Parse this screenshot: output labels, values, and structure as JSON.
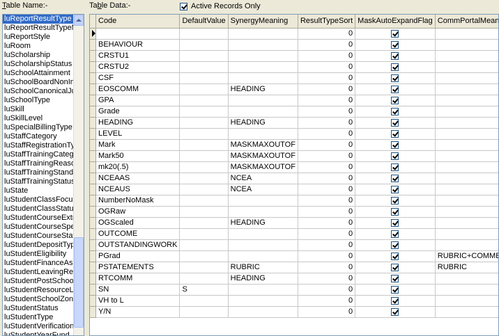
{
  "labels": {
    "table_name": "Table Name:-",
    "table_name_accel": "T",
    "table_name_rest": "able Name:-",
    "table_data_pre": "Ta",
    "table_data_accel": "b",
    "table_data_rest": "le Data:-",
    "active_records": "Active Records Only",
    "active_checked": true
  },
  "table_list": [
    "luReportResultType",
    "luReportResultTypeM",
    "luReportStyle",
    "luRoom",
    "luScholarship",
    "luScholarshipStatus",
    "luSchoolAttainment",
    "luSchoolBoardNonIn",
    "luSchoolCanonicalJu",
    "luSchoolType",
    "luSkill",
    "luSkillLevel",
    "luSpecialBillingType",
    "luStaffCategory",
    "luStaffRegistrationTyp",
    "luStaffTrainingCatego",
    "luStaffTrainingReaso",
    "luStaffTrainingStanda",
    "luStaffTrainingStatus",
    "luState",
    "luStudentClassFocus",
    "luStudentClassStatus",
    "luStudentCourseExtra",
    "luStudentCourseSpec",
    "luStudentCourseStatu",
    "luStudentDepositTyp",
    "luStudentEligibility",
    "luStudentFinanceAss",
    "luStudentLeavingRea",
    "luStudentPostSchool",
    "luStudentResourceLe",
    "luStudentSchoolZone",
    "luStudentStatus",
    "luStudentType",
    "luStudentVerificationD",
    "luStudentYearFund"
  ],
  "grid": {
    "columns": [
      "Code",
      "DefaultValue",
      "SynergyMeaning",
      "ResultTypeSort",
      "MaskAutoExpandFlag",
      "CommPortalMeaning"
    ],
    "rows": [
      [
        "",
        "",
        "",
        "0",
        true,
        ""
      ],
      [
        "BEHAVIOUR",
        "",
        "",
        "0",
        true,
        ""
      ],
      [
        "CRSTU1",
        "",
        "",
        "0",
        true,
        ""
      ],
      [
        "CRSTU2",
        "",
        "",
        "0",
        true,
        ""
      ],
      [
        "CSF",
        "",
        "",
        "0",
        true,
        ""
      ],
      [
        "EOSCOMM",
        "",
        "HEADING",
        "0",
        true,
        ""
      ],
      [
        "GPA",
        "",
        "",
        "0",
        true,
        ""
      ],
      [
        "Grade",
        "",
        "",
        "0",
        true,
        ""
      ],
      [
        "HEADING",
        "",
        "HEADING",
        "0",
        true,
        ""
      ],
      [
        "LEVEL",
        "",
        "",
        "0",
        true,
        ""
      ],
      [
        "Mark",
        "",
        "MASKMAXOUTOF",
        "0",
        true,
        ""
      ],
      [
        "Mark50",
        "",
        "MASKMAXOUTOF",
        "0",
        true,
        ""
      ],
      [
        "mk20(.5)",
        "",
        "MASKMAXOUTOF",
        "0",
        true,
        ""
      ],
      [
        "NCEAAS",
        "",
        "NCEA",
        "0",
        true,
        ""
      ],
      [
        "NCEAUS",
        "",
        "NCEA",
        "0",
        true,
        ""
      ],
      [
        "NumberNoMask",
        "",
        "",
        "0",
        true,
        ""
      ],
      [
        "OGRaw",
        "",
        "",
        "0",
        true,
        ""
      ],
      [
        "OGScaled",
        "",
        "HEADING",
        "0",
        true,
        ""
      ],
      [
        "OUTCOME",
        "",
        "",
        "0",
        true,
        ""
      ],
      [
        "OUTSTANDINGWORK",
        "",
        "",
        "0",
        true,
        ""
      ],
      [
        "PGrad",
        "",
        "",
        "0",
        true,
        "RUBRIC+COMMENT"
      ],
      [
        "PSTATEMENTS",
        "",
        "RUBRIC",
        "0",
        true,
        "RUBRIC"
      ],
      [
        "RTCOMM",
        "",
        "HEADING",
        "0",
        true,
        ""
      ],
      [
        "SN",
        "S",
        "",
        "0",
        true,
        ""
      ],
      [
        "VH to L",
        "",
        "",
        "0",
        true,
        ""
      ],
      [
        "Y/N",
        "",
        "",
        "0",
        true,
        ""
      ]
    ]
  }
}
